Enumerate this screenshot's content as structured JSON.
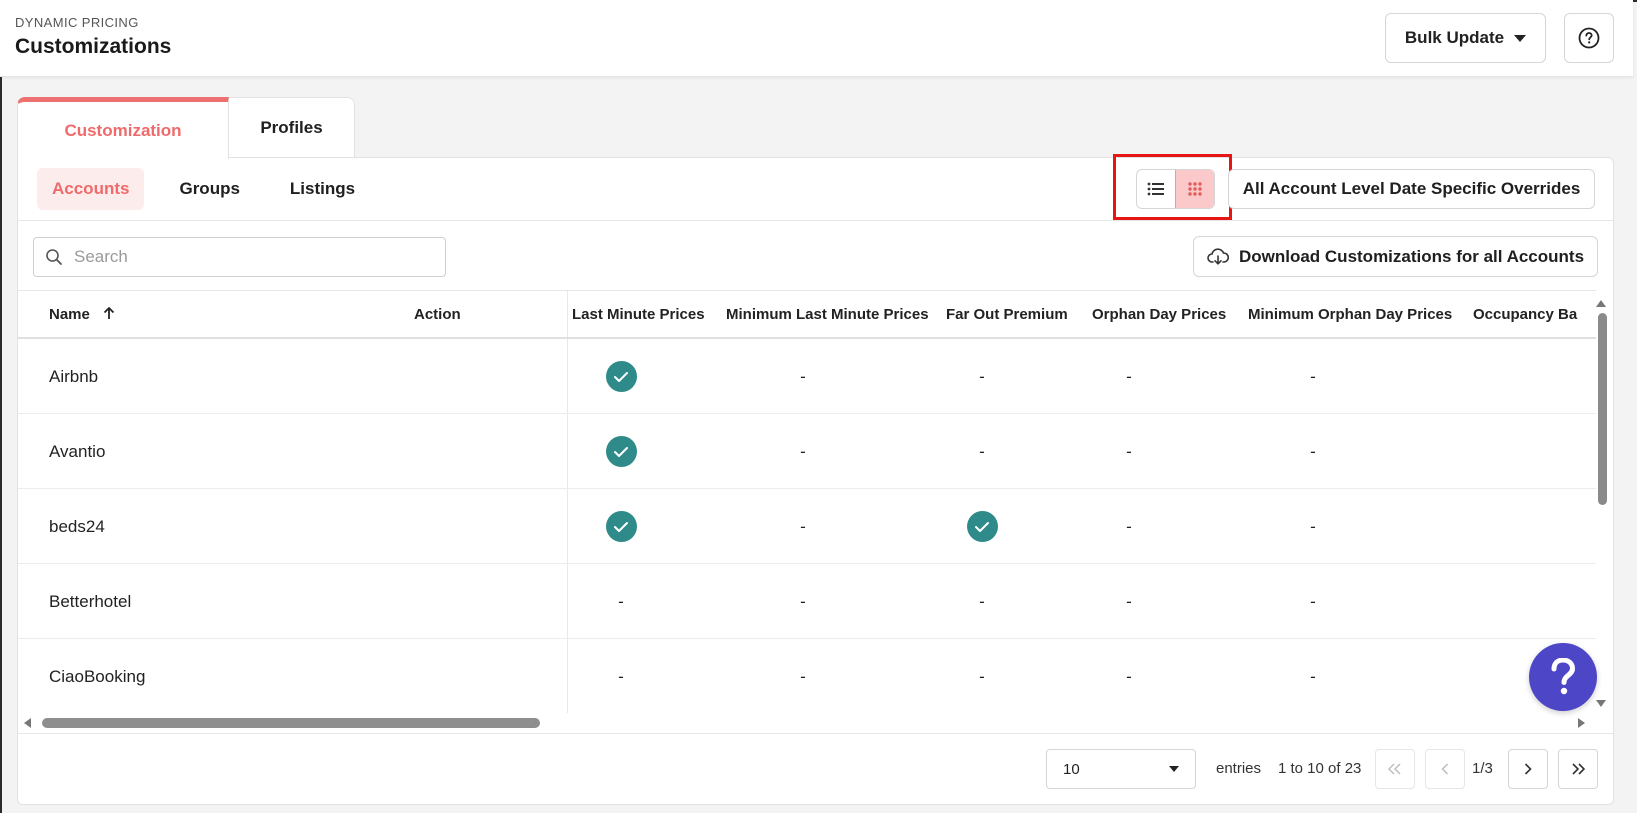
{
  "header": {
    "eyebrow": "DYNAMIC PRICING",
    "title": "Customizations",
    "bulk_update_label": "Bulk Update"
  },
  "main_tabs": [
    {
      "label": "Customization",
      "active": true
    },
    {
      "label": "Profiles",
      "active": false
    }
  ],
  "sub_tabs": [
    {
      "label": "Accounts",
      "active": true
    },
    {
      "label": "Groups",
      "active": false
    },
    {
      "label": "Listings",
      "active": false
    }
  ],
  "view_toggle": {
    "selected": "grid"
  },
  "overrides_button_label": "All Account Level Date Specific Overrides",
  "search": {
    "placeholder": "Search",
    "value": ""
  },
  "download_button_label": "Download Customizations for all Accounts",
  "table": {
    "columns": [
      "Name",
      "Action",
      "Last Minute Prices",
      "Minimum Last Minute Prices",
      "Far Out Premium",
      "Orphan Day Prices",
      "Minimum Orphan Day Prices",
      "Occupancy Ba"
    ],
    "sort": {
      "column": "Name",
      "direction": "asc"
    },
    "rows": [
      {
        "name": "Airbnb",
        "last_minute": "check",
        "min_last_minute": "-",
        "far_out": "-",
        "orphan": "-",
        "min_orphan": "-"
      },
      {
        "name": "Avantio",
        "last_minute": "check",
        "min_last_minute": "-",
        "far_out": "-",
        "orphan": "-",
        "min_orphan": "-"
      },
      {
        "name": "beds24",
        "last_minute": "check",
        "min_last_minute": "-",
        "far_out": "check",
        "orphan": "-",
        "min_orphan": "-"
      },
      {
        "name": "Betterhotel",
        "last_minute": "-",
        "min_last_minute": "-",
        "far_out": "-",
        "orphan": "-",
        "min_orphan": "-"
      },
      {
        "name": "CiaoBooking",
        "last_minute": "-",
        "min_last_minute": "-",
        "far_out": "-",
        "orphan": "-",
        "min_orphan": "-"
      }
    ]
  },
  "pagination": {
    "page_size": "10",
    "entries_label": "entries",
    "range": "1 to 10 of 23",
    "page_indicator": "1/3"
  },
  "colors": {
    "accent": "#ef6b6b",
    "check": "#2f8b8a",
    "fab": "#4d47c7",
    "highlight": "#e81515"
  }
}
